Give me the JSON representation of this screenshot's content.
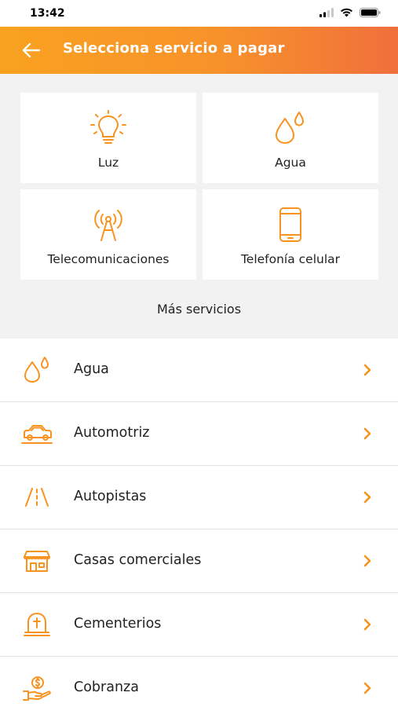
{
  "status_bar": {
    "time": "13:42"
  },
  "header": {
    "title": "Selecciona servicio a pagar"
  },
  "featured": [
    {
      "label": "Luz",
      "icon": "lightbulb-icon"
    },
    {
      "label": "Agua",
      "icon": "water-drops-icon"
    },
    {
      "label": "Telecomunicaciones",
      "icon": "antenna-icon"
    },
    {
      "label": "Telefonía celular",
      "icon": "smartphone-icon"
    }
  ],
  "more_services_title": "Más servicios",
  "services": [
    {
      "label": "Agua",
      "icon": "water-drops-icon"
    },
    {
      "label": "Automotriz",
      "icon": "car-icon"
    },
    {
      "label": "Autopistas",
      "icon": "highway-icon"
    },
    {
      "label": "Casas comerciales",
      "icon": "storefront-icon"
    },
    {
      "label": "Cementerios",
      "icon": "tombstone-icon"
    },
    {
      "label": "Cobranza",
      "icon": "money-hand-icon"
    }
  ],
  "colors": {
    "accent": "#f7931e",
    "header_start": "#f9a21f",
    "header_end": "#f06f3c"
  }
}
